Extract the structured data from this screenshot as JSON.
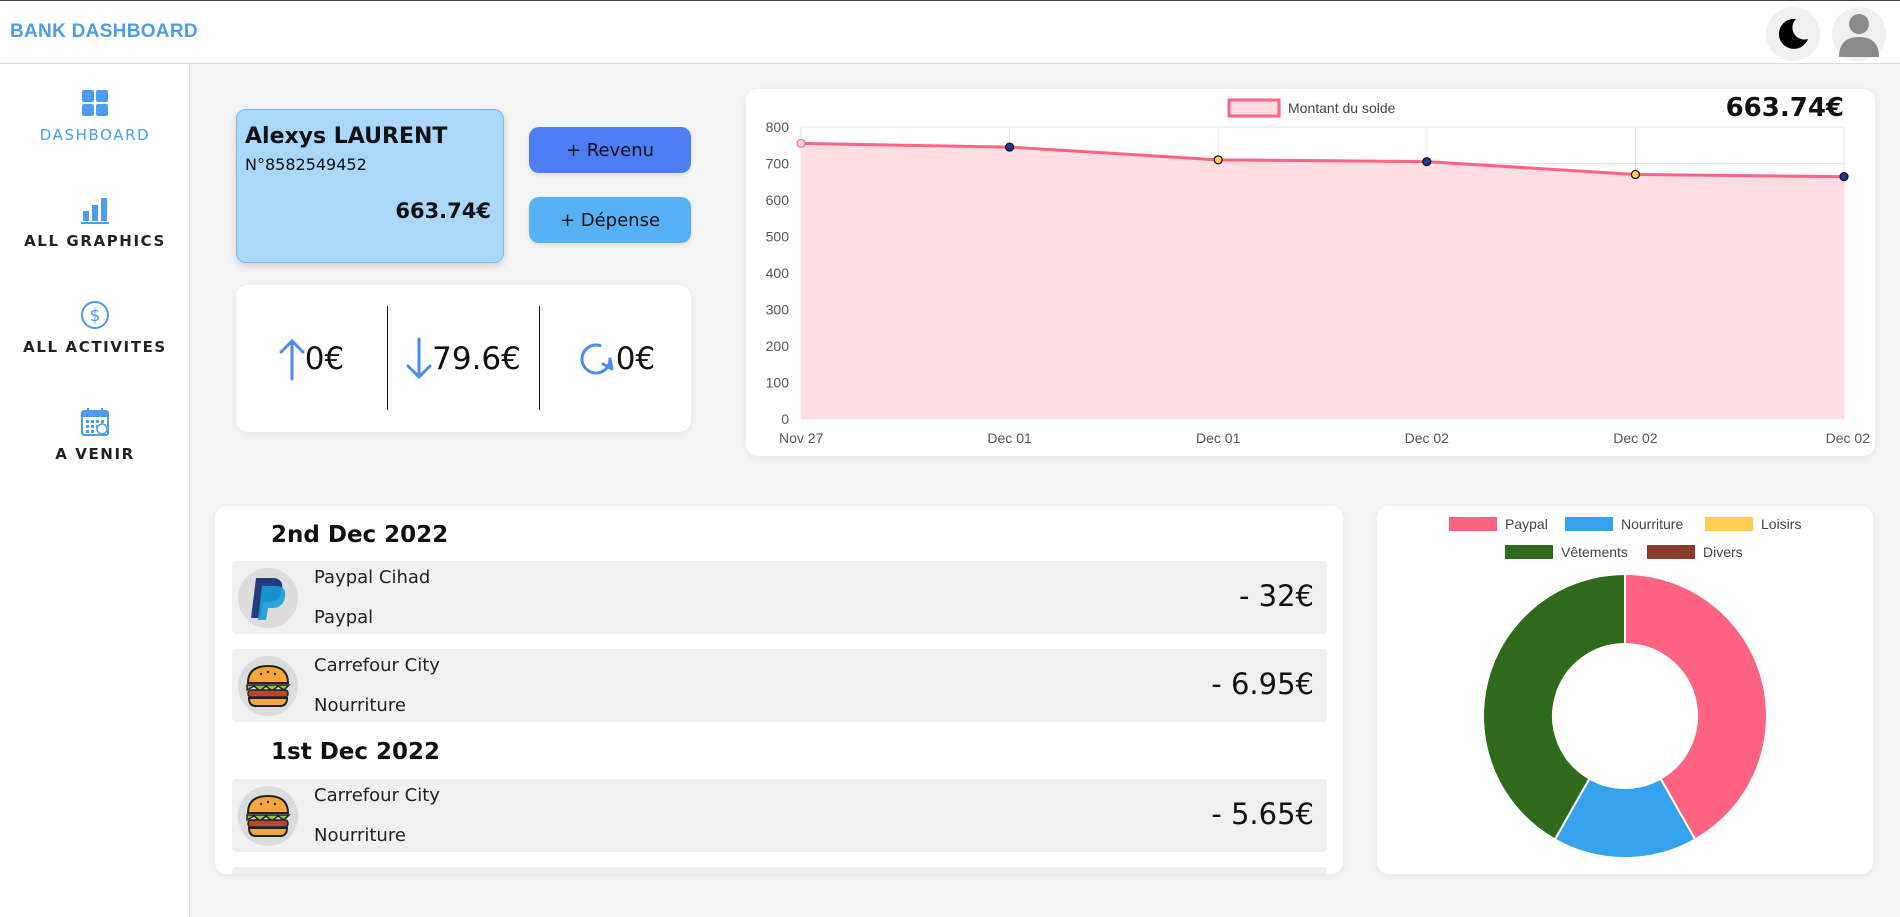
{
  "header": {
    "brand": "BANK DASHBOARD",
    "theme_toggle_icon": "moon-icon",
    "profile_icon": "user-icon"
  },
  "sidebar": {
    "items": [
      {
        "label": "DASHBOARD",
        "icon": "dashboard-icon",
        "active": true
      },
      {
        "label": "ALL GRAPHICS",
        "icon": "bar-chart-icon",
        "active": false
      },
      {
        "label": "ALL ACTIVITES",
        "icon": "dollar-icon",
        "active": false
      },
      {
        "label": "A VENIR",
        "icon": "calendar-icon",
        "active": false
      }
    ]
  },
  "account": {
    "name": "Alexys LAURENT",
    "number": "N°8582549452",
    "balance": "663.74€"
  },
  "actions": {
    "income_label": "+ Revenu",
    "expense_label": "+ Dépense"
  },
  "stats": {
    "income": "0€",
    "expense": "79.6€",
    "recurring": "0€"
  },
  "colors": {
    "accent": "#4a9df0",
    "line": "#ff6384",
    "line_fill": "#ffdde3",
    "paypal": "#ff6384",
    "nourriture": "#36a2eb",
    "loisirs": "#ffcd56",
    "vetements": "#2f6b1b",
    "divers": "#8b3a30"
  },
  "chart_total": "663.74€",
  "chart_data": [
    {
      "type": "line",
      "legend": "Montant du solde",
      "x": [
        "Nov 27",
        "Dec 01",
        "Dec 01",
        "Dec 02",
        "Dec 02",
        "Dec 02"
      ],
      "y": [
        755,
        745,
        710,
        705,
        670,
        664
      ],
      "ylim": [
        0,
        800
      ],
      "yticks": [
        "0",
        "100",
        "200",
        "300",
        "400",
        "500",
        "600",
        "700",
        "800"
      ],
      "grid": true,
      "legend_position": "top"
    },
    {
      "type": "pie",
      "labels": [
        "Paypal",
        "Nourriture",
        "Loisirs",
        "Vêtements",
        "Divers"
      ],
      "values": [
        32,
        12.6,
        0,
        32,
        0
      ],
      "legend_position": "top"
    }
  ],
  "transactions": {
    "groups": [
      {
        "date": "2nd Dec 2022",
        "items": [
          {
            "name": "Paypal Cihad",
            "category": "Paypal",
            "amount": "- 32€",
            "icon": "paypal-icon"
          },
          {
            "name": "Carrefour City",
            "category": "Nourriture",
            "amount": "- 6.95€",
            "icon": "burger-icon"
          }
        ]
      },
      {
        "date": "1st Dec 2022",
        "items": [
          {
            "name": "Carrefour City",
            "category": "Nourriture",
            "amount": "- 5.65€",
            "icon": "burger-icon"
          }
        ]
      }
    ]
  }
}
